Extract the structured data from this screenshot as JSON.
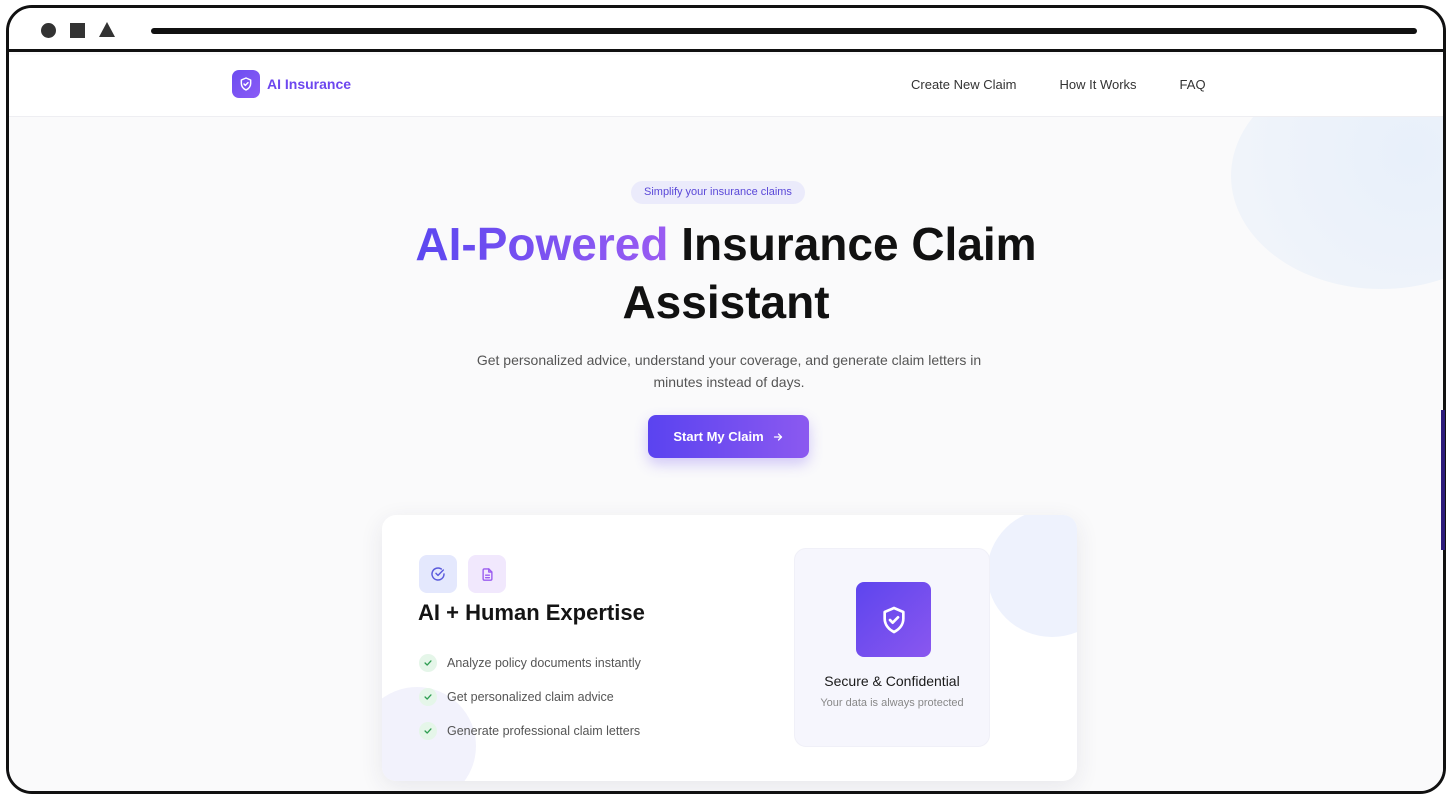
{
  "brand": {
    "name": "AI Insurance",
    "icon": "shield-check-icon",
    "accent": "#6d47ef"
  },
  "nav": {
    "links": [
      "Create New Claim",
      "How It Works",
      "FAQ"
    ]
  },
  "hero": {
    "pill": "Simplify your insurance claims",
    "headline_accent": "AI-Powered",
    "headline_rest": " Insurance Claim",
    "headline_line2": "Assistant",
    "subhead": "Get personalized advice, understand your coverage, and generate claim letters in minutes instead of days.",
    "cta_label": "Start My Claim",
    "cta_icon": "arrow-right-icon"
  },
  "feature_card": {
    "icons": [
      "check-circle-icon",
      "document-icon"
    ],
    "title": "AI + Human Expertise",
    "features": [
      "Analyze policy documents instantly",
      "Get personalized claim advice",
      "Generate professional claim letters"
    ],
    "secure": {
      "icon": "shield-check-icon",
      "title": "Secure & Confidential",
      "subtitle": "Your data is always protected"
    }
  },
  "colors": {
    "primary_start": "#5a43f0",
    "primary_end": "#8b59f0",
    "check_green": "#2f9e52"
  }
}
